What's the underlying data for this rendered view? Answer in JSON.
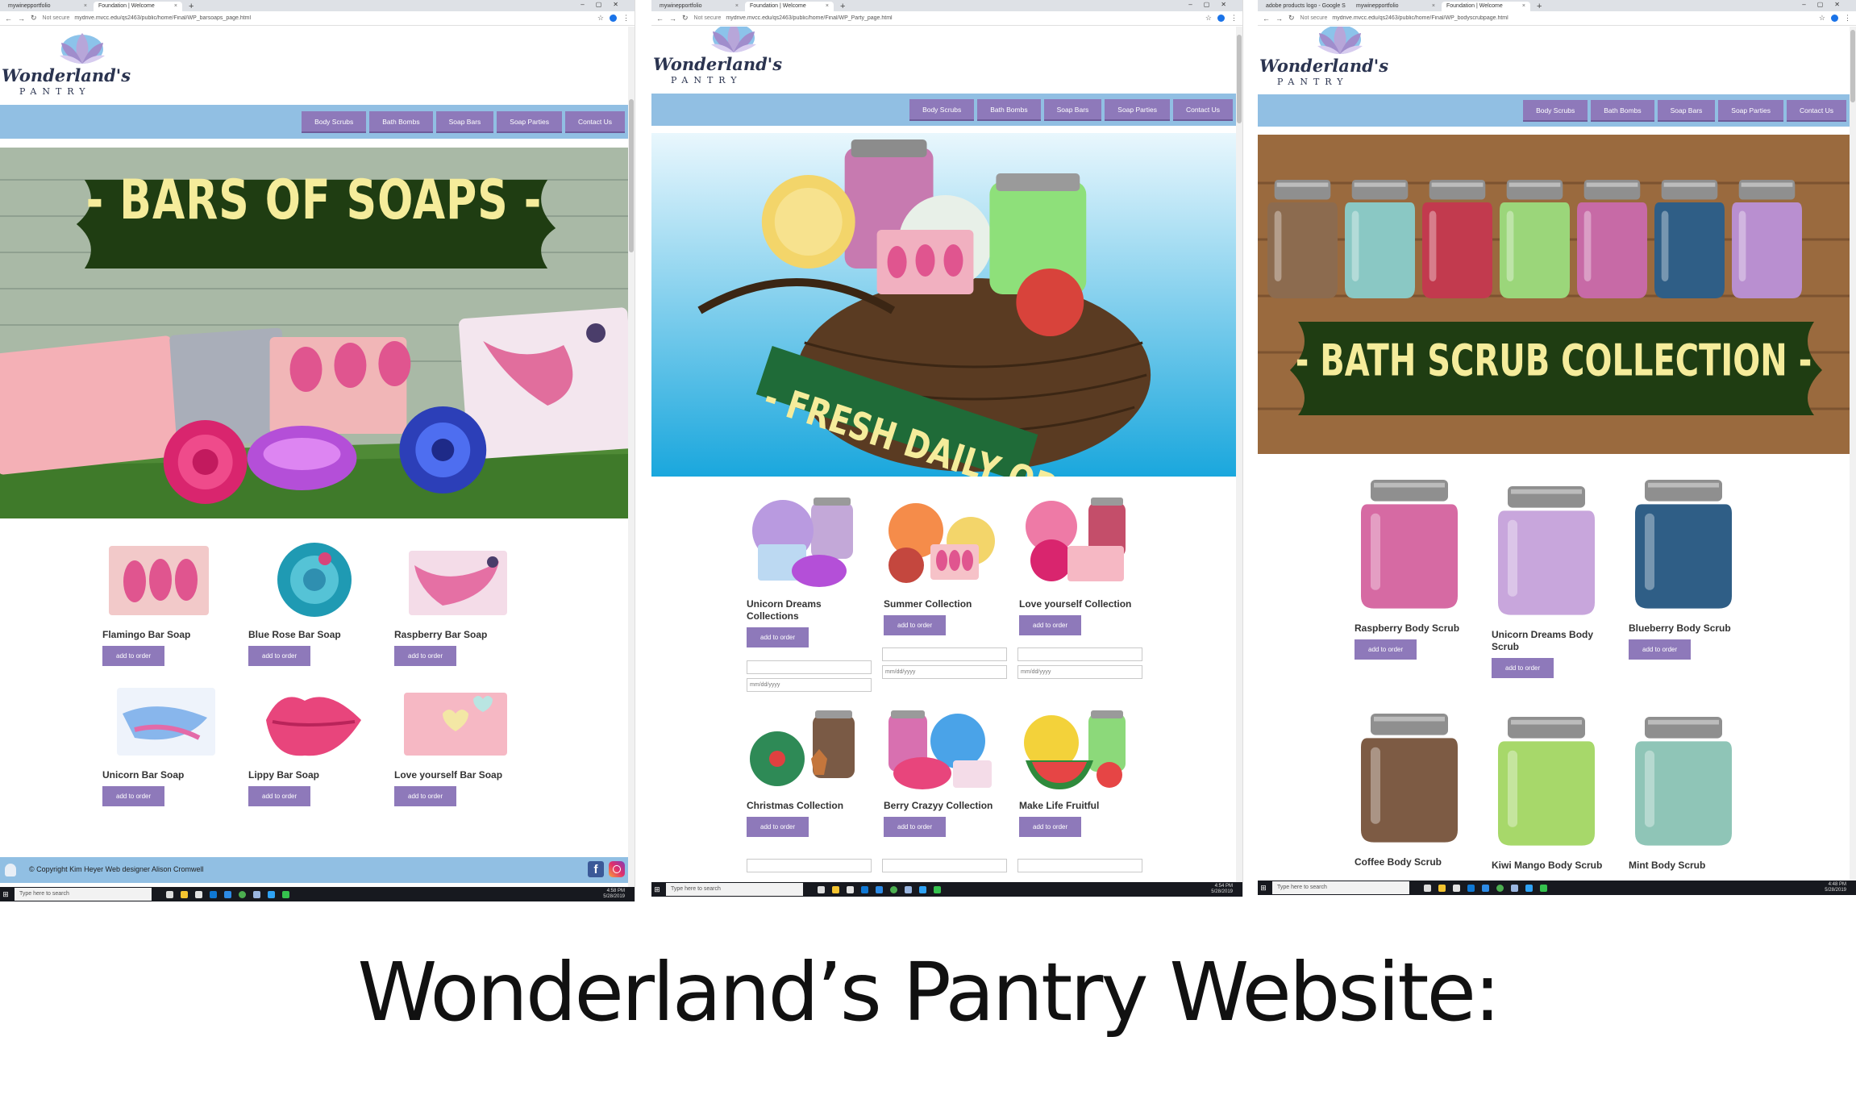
{
  "caption": "Wonderland’s Pantry Website:",
  "brand": {
    "script": "Wonderland's",
    "sub": "PANTRY"
  },
  "nav": [
    "Body Scrubs",
    "Bath Bombs",
    "Soap Bars",
    "Soap Parties",
    "Contact Us"
  ],
  "order_label": "add to order",
  "date_placeholder": "mm/dd/yyyy",
  "colors": {
    "nav_bar": "#91bfe3",
    "nav_button": "#8e79ba",
    "banner_ribbon": "#1f3d12",
    "banner_text": "#f5ec9b"
  },
  "screens": [
    {
      "tabs": [
        "mywinepportfolio",
        "Foundation | Welcome"
      ],
      "url_security": "Not secure",
      "url": "mydrive.mvcc.edu/qs2463/public/home/Final/WP_barsoaps_page.html",
      "banner_title": "- BARS OF SOAPS -",
      "products": [
        "Flamingo Bar Soap",
        "Blue Rose Bar Soap",
        "Raspberry Bar Soap",
        "Unicorn Bar Soap",
        "Lippy Bar Soap",
        "Love yourself Bar Soap"
      ],
      "footer": "Copyright Kim Heyer Web designer Alison Cromwell",
      "taskbar_search": "Type here to search",
      "time": "4:58 PM",
      "date": "5/28/2019"
    },
    {
      "tabs": [
        "mywinepportfolio",
        "Foundation | Welcome"
      ],
      "url_security": "Not secure",
      "url": "mydrive.mvcc.edu/qs2463/public/home/Final/WP_Party_page.html",
      "banner_title": "- FRESH DAILY ORDERS -",
      "products": [
        "Unicorn Dreams Collections",
        "Summer Collection",
        "Love yourself Collection",
        "Christmas Collection",
        "Berry Crazyy Collection",
        "Make Life Fruitful"
      ],
      "taskbar_search": "Type here to search",
      "time": "4:54 PM",
      "date": "5/28/2019"
    },
    {
      "tabs": [
        "adobe products logo - Google S",
        "mywinepportfolio",
        "Foundation | Welcome"
      ],
      "url_security": "Not secure",
      "url": "mydrive.mvcc.edu/qs2463/public/home/Final/WP_bodyscrubpage.html",
      "banner_title": "- BATH SCRUB COLLECTION -",
      "products": [
        "Raspberry Body Scrub",
        "Unicorn Dreams Body Scrub",
        "Blueberry Body Scrub",
        "Coffee Body Scrub",
        "Kiwi Mango Body Scrub",
        "Mint Body Scrub"
      ],
      "taskbar_search": "Type here to search",
      "time": "4:48 PM",
      "date": "5/28/2019"
    }
  ]
}
